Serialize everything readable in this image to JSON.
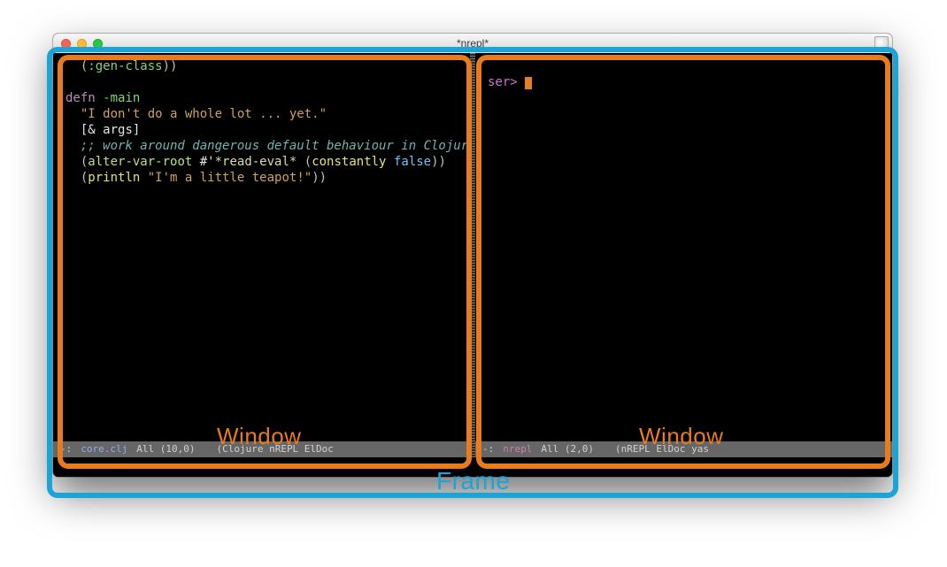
{
  "diagram": {
    "frame_label": "Frame",
    "window_label_left": "Window",
    "window_label_right": "Window"
  },
  "titlebar": {
    "title": "*nrepl*"
  },
  "left_pane": {
    "code_lines": [
      {
        "segments": [
          {
            "t": "  ",
            "c": "punc"
          },
          {
            "t": "(",
            "c": "punc"
          },
          {
            "t": ":gen-class",
            "c": "fn"
          },
          {
            "t": "))",
            "c": "punc"
          }
        ]
      },
      {
        "segments": [
          {
            "t": "",
            "c": "white"
          }
        ]
      },
      {
        "segments": [
          {
            "t": "defn",
            "c": "kw"
          },
          {
            "t": " ",
            "c": "white"
          },
          {
            "t": "-main",
            "c": "fn"
          }
        ]
      },
      {
        "segments": [
          {
            "t": "  ",
            "c": "white"
          },
          {
            "t": "\"I don't do a whole lot ... yet.\"",
            "c": "str"
          }
        ]
      },
      {
        "segments": [
          {
            "t": "  [",
            "c": "white"
          },
          {
            "t": "&",
            "c": "white"
          },
          {
            "t": " args]",
            "c": "white"
          }
        ]
      },
      {
        "segments": [
          {
            "t": "  ;; work around dangerous default behaviour in Clojure",
            "c": "comment"
          }
        ]
      },
      {
        "segments": [
          {
            "t": "  (",
            "c": "punc"
          },
          {
            "t": "alter-var-root",
            "c": "fn2"
          },
          {
            "t": " #'",
            "c": "white"
          },
          {
            "t": "*read-eval*",
            "c": "sym"
          },
          {
            "t": " (",
            "c": "punc"
          },
          {
            "t": "constantly",
            "c": "yellow"
          },
          {
            "t": " ",
            "c": "white"
          },
          {
            "t": "false",
            "c": "const"
          },
          {
            "t": "))",
            "c": "punc"
          }
        ]
      },
      {
        "segments": [
          {
            "t": "  (",
            "c": "punc"
          },
          {
            "t": "println",
            "c": "yellow"
          },
          {
            "t": " ",
            "c": "white"
          },
          {
            "t": "\"I'm a little teapot!\"",
            "c": "str"
          },
          {
            "t": "))",
            "c": "punc"
          }
        ]
      }
    ],
    "modeline": {
      "prefix": "-:",
      "buffer": "core.clj",
      "position": "All (10,0)",
      "modes": "(Clojure nREPL ElDoc"
    }
  },
  "right_pane": {
    "prompt": "ser> ",
    "modeline": {
      "prefix": "-:",
      "buffer": "nrepl",
      "position": "All (2,0)",
      "modes": "(nREPL ElDoc yas"
    }
  }
}
